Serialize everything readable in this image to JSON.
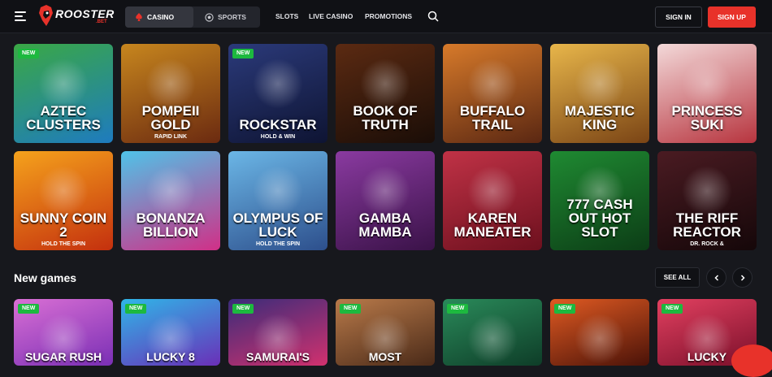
{
  "brand": {
    "name": "ROOSTER",
    "suffix": ".BET",
    "accent": "#e8322a"
  },
  "header": {
    "menu_icon": "hamburger-icon",
    "segments": [
      {
        "label": "CASINO",
        "icon": "spade-icon",
        "active": true
      },
      {
        "label": "SPORTS",
        "icon": "soccer-ball-icon",
        "active": false
      }
    ],
    "nav": [
      "SLOTS",
      "LIVE CASINO",
      "PROMOTIONS"
    ],
    "search_icon": "search-icon",
    "signin_label": "SIGN IN",
    "signup_label": "SIGN UP"
  },
  "grid": {
    "rows": [
      [
        {
          "title": "AZTEC CLUSTERS",
          "subtitle": "",
          "badge": "NEW",
          "bg": [
            "#3aa845",
            "#1e7bbf"
          ]
        },
        {
          "title": "POMPEII GOLD",
          "subtitle": "RAPID LINK",
          "badge": "",
          "bg": [
            "#c7861e",
            "#6b2a10"
          ]
        },
        {
          "title": "ROCKSTAR",
          "subtitle": "HOLD & WIN",
          "badge": "NEW",
          "bg": [
            "#2b3a7a",
            "#0e1433"
          ]
        },
        {
          "title": "BOOK OF TRUTH",
          "subtitle": "",
          "badge": "",
          "bg": [
            "#5b2a12",
            "#1a0d07"
          ]
        },
        {
          "title": "BUFFALO TRAIL",
          "subtitle": "",
          "badge": "",
          "bg": [
            "#d77a2a",
            "#5a2712"
          ]
        },
        {
          "title": "MAJESTIC KING",
          "subtitle": "",
          "badge": "",
          "bg": [
            "#e8b64a",
            "#7a4415"
          ]
        },
        {
          "title": "PRINCESS SUKI",
          "subtitle": "",
          "badge": "",
          "bg": [
            "#f3d9d9",
            "#b7343e"
          ]
        }
      ],
      [
        {
          "title": "SUNNY COIN 2",
          "subtitle": "HOLD THE SPIN",
          "badge": "",
          "bg": [
            "#f5a21c",
            "#c4300e"
          ]
        },
        {
          "title": "BONANZA BILLION",
          "subtitle": "",
          "badge": "",
          "bg": [
            "#4fc3e8",
            "#d12f87"
          ]
        },
        {
          "title": "OLYMPUS OF LUCK",
          "subtitle": "HOLD THE SPIN",
          "badge": "",
          "bg": [
            "#6bb6e6",
            "#2d4f8c"
          ]
        },
        {
          "title": "GAMBA MAMBA",
          "subtitle": "",
          "badge": "",
          "bg": [
            "#8a3aa0",
            "#3a1248"
          ]
        },
        {
          "title": "KAREN MANEATER",
          "subtitle": "",
          "badge": "",
          "bg": [
            "#c03246",
            "#6d101e"
          ]
        },
        {
          "title": "777 CASH OUT HOT SLOT",
          "subtitle": "",
          "badge": "",
          "bg": [
            "#1f8a32",
            "#0c3d16"
          ]
        },
        {
          "title": "THE RIFF REACTOR",
          "subtitle": "DR. ROCK &",
          "badge": "",
          "bg": [
            "#4a1b22",
            "#150709"
          ]
        }
      ]
    ]
  },
  "new_games": {
    "title": "New games",
    "see_all": "SEE ALL",
    "prev_icon": "chevron-left-icon",
    "next_icon": "chevron-right-icon",
    "tiles": [
      {
        "title": "SUGAR RUSH",
        "badge": "NEW",
        "bg": [
          "#d96fd4",
          "#7a2fb5"
        ]
      },
      {
        "title": "LUCKY 8",
        "badge": "NEW",
        "bg": [
          "#2fb6e8",
          "#6a2fb8"
        ]
      },
      {
        "title": "SAMURAI'S",
        "badge": "NEW",
        "bg": [
          "#3a2c7a",
          "#d2316e"
        ]
      },
      {
        "title": "MOST",
        "badge": "NEW",
        "bg": [
          "#b97a4a",
          "#4a2a18"
        ]
      },
      {
        "title": "",
        "badge": "NEW",
        "bg": [
          "#2a8a5a",
          "#0e3d28"
        ]
      },
      {
        "title": "",
        "badge": "NEW",
        "bg": [
          "#e05a22",
          "#4a1208"
        ]
      },
      {
        "title": "LUCKY",
        "badge": "NEW",
        "bg": [
          "#e24060",
          "#7a0f2a"
        ]
      }
    ]
  },
  "chat_icon": "chat-bubble-icon"
}
